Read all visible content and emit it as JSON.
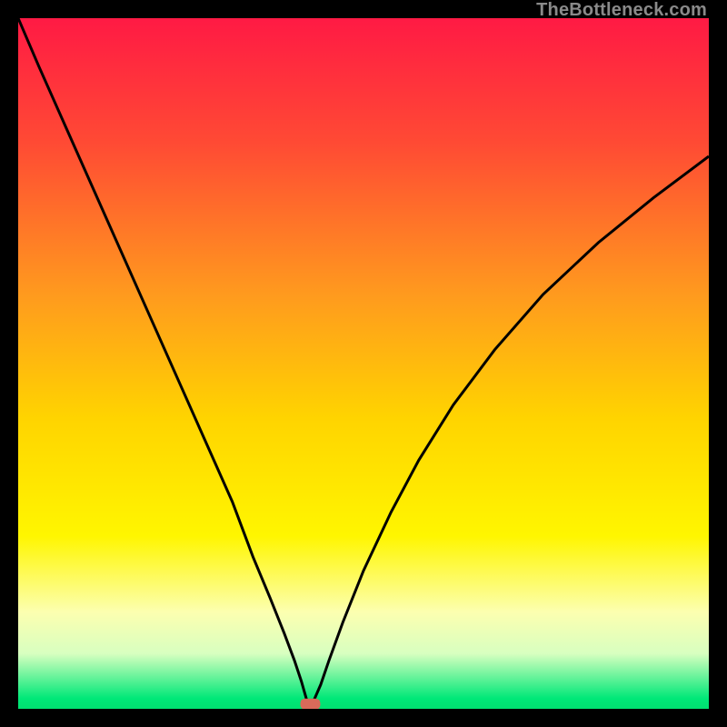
{
  "watermark": "TheBottleneck.com",
  "chart_data": {
    "type": "line",
    "title": "",
    "xlabel": "",
    "ylabel": "",
    "xlim": [
      0,
      100
    ],
    "ylim": [
      0,
      100
    ],
    "grid": false,
    "legend": false,
    "background_gradient": {
      "stops": [
        {
          "offset": 0.0,
          "color": "#ff1a44"
        },
        {
          "offset": 0.18,
          "color": "#ff4a34"
        },
        {
          "offset": 0.4,
          "color": "#ff9a1e"
        },
        {
          "offset": 0.58,
          "color": "#ffd400"
        },
        {
          "offset": 0.75,
          "color": "#fff600"
        },
        {
          "offset": 0.86,
          "color": "#fcffb0"
        },
        {
          "offset": 0.92,
          "color": "#d8ffc0"
        },
        {
          "offset": 0.985,
          "color": "#00e878"
        },
        {
          "offset": 1.0,
          "color": "#00e070"
        }
      ]
    },
    "marker": {
      "x": 42.3,
      "y": 0.7,
      "color": "#d86a5a"
    },
    "series": [
      {
        "name": "curve",
        "color": "#000000",
        "x": [
          0.0,
          3,
          7,
          11,
          15,
          19,
          23,
          27,
          31,
          34,
          36.5,
          38.5,
          40.0,
          41.0,
          41.8,
          42.8,
          43.8,
          45.0,
          47.0,
          50.0,
          54.0,
          58.0,
          63.0,
          69.0,
          76.0,
          84.0,
          92.0,
          100.0
        ],
        "values": [
          100,
          93,
          84,
          75,
          66,
          57,
          48,
          39,
          30,
          22,
          16,
          11,
          7,
          4,
          1.2,
          1.2,
          3.5,
          7.0,
          12.5,
          20.0,
          28.5,
          36.0,
          44.0,
          52.0,
          60.0,
          67.5,
          74.0,
          80.0
        ]
      }
    ]
  }
}
